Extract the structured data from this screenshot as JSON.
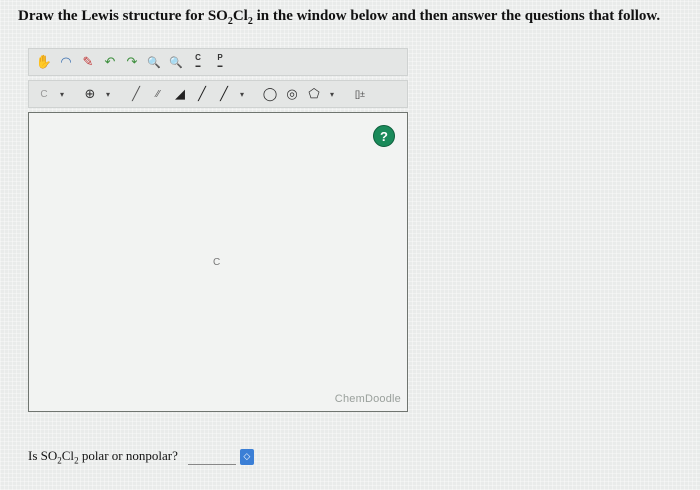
{
  "question": {
    "prefix": "Draw the Lewis structure for ",
    "formula_s": "SO",
    "formula_sub1": "2",
    "formula_cl": "Cl",
    "formula_sub2": "2",
    "suffix": " in the window below and then answer the questions that follow."
  },
  "toolbar1": [
    {
      "name": "hand-icon",
      "glyph": "✋",
      "color": "#8a5a2a"
    },
    {
      "name": "lasso-icon",
      "glyph": "◠",
      "color": "#3a6fb0"
    },
    {
      "name": "eraser-icon",
      "glyph": "✎",
      "color": "#c03030"
    },
    {
      "name": "undo-icon",
      "glyph": "↶",
      "color": "#3d8f3d"
    },
    {
      "name": "redo-icon",
      "glyph": "↷",
      "color": "#3d8f3d"
    },
    {
      "name": "zoom-in-icon",
      "glyph": "🔍",
      "color": "#2a4f86"
    },
    {
      "name": "zoom-out-icon",
      "glyph": "🔍",
      "color": "#2a4f86"
    }
  ],
  "toolbar2": {
    "atom_label": "C",
    "charge_glyph": "⊕",
    "ring_glyphs": [
      "◯",
      "◎",
      "⬠"
    ],
    "bracket_glyph": "[]±"
  },
  "canvas": {
    "help_glyph": "?",
    "atom_c": "C",
    "brand": "ChemDoodle"
  },
  "polar_question": {
    "prefix": "Is ",
    "formula_s": "SO",
    "formula_sub1": "2",
    "formula_cl": "Cl",
    "formula_sub2": "2",
    "suffix": " polar or nonpolar?",
    "dropdown_glyph": "◇"
  }
}
